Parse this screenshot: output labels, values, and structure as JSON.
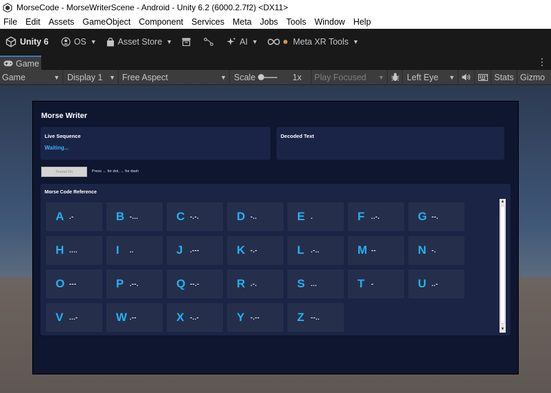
{
  "window": {
    "title": "MorseCode - MorseWriterScene - Android - Unity 6.2 (6000.2.7f2) <DX11>"
  },
  "menu": [
    "File",
    "Edit",
    "Assets",
    "GameObject",
    "Component",
    "Services",
    "Meta",
    "Jobs",
    "Tools",
    "Window",
    "Help"
  ],
  "toolbar": {
    "unity_label": "Unity 6",
    "os_label": "OS",
    "asset_store_label": "Asset Store",
    "ai_label": "AI",
    "meta_xr_label": "Meta XR Tools"
  },
  "tabs": {
    "game_label": "Game"
  },
  "gamebar": {
    "view_label": "Game",
    "display_label": "Display 1",
    "aspect_label": "Free Aspect",
    "scale_label": "Scale",
    "scale_value": "1x",
    "play_focused_label": "Play Focused",
    "eye_label": "Left Eye",
    "stats_label": "Stats",
    "gizmos_label": "Gizmo"
  },
  "app": {
    "title": "Morse Writer",
    "live_sequence_label": "Live Sequence",
    "live_sequence_value": "Waiting...",
    "decoded_text_label": "Decoded Text",
    "decoded_text_value": "",
    "sound_button_label": "Sound On",
    "hint": "Press ← for dot, → for dash",
    "reference_label": "Morse Code Reference",
    "letters": [
      {
        "letter": "A",
        "code": ".-"
      },
      {
        "letter": "B",
        "code": "-..."
      },
      {
        "letter": "C",
        "code": "-.-."
      },
      {
        "letter": "D",
        "code": "-.."
      },
      {
        "letter": "E",
        "code": "."
      },
      {
        "letter": "F",
        "code": "..-."
      },
      {
        "letter": "G",
        "code": "--."
      },
      {
        "letter": "H",
        "code": "...."
      },
      {
        "letter": "I",
        "code": ".."
      },
      {
        "letter": "J",
        "code": ".---"
      },
      {
        "letter": "K",
        "code": "-.-"
      },
      {
        "letter": "L",
        "code": ".-.."
      },
      {
        "letter": "M",
        "code": "--"
      },
      {
        "letter": "N",
        "code": "-."
      },
      {
        "letter": "O",
        "code": "---"
      },
      {
        "letter": "P",
        "code": ".--."
      },
      {
        "letter": "Q",
        "code": "--.-"
      },
      {
        "letter": "R",
        "code": ".-."
      },
      {
        "letter": "S",
        "code": "..."
      },
      {
        "letter": "T",
        "code": "-"
      },
      {
        "letter": "U",
        "code": "..-"
      },
      {
        "letter": "V",
        "code": "...-"
      },
      {
        "letter": "W",
        "code": ".--"
      },
      {
        "letter": "X",
        "code": "-..-"
      },
      {
        "letter": "Y",
        "code": "-.--"
      },
      {
        "letter": "Z",
        "code": "--.."
      }
    ]
  }
}
